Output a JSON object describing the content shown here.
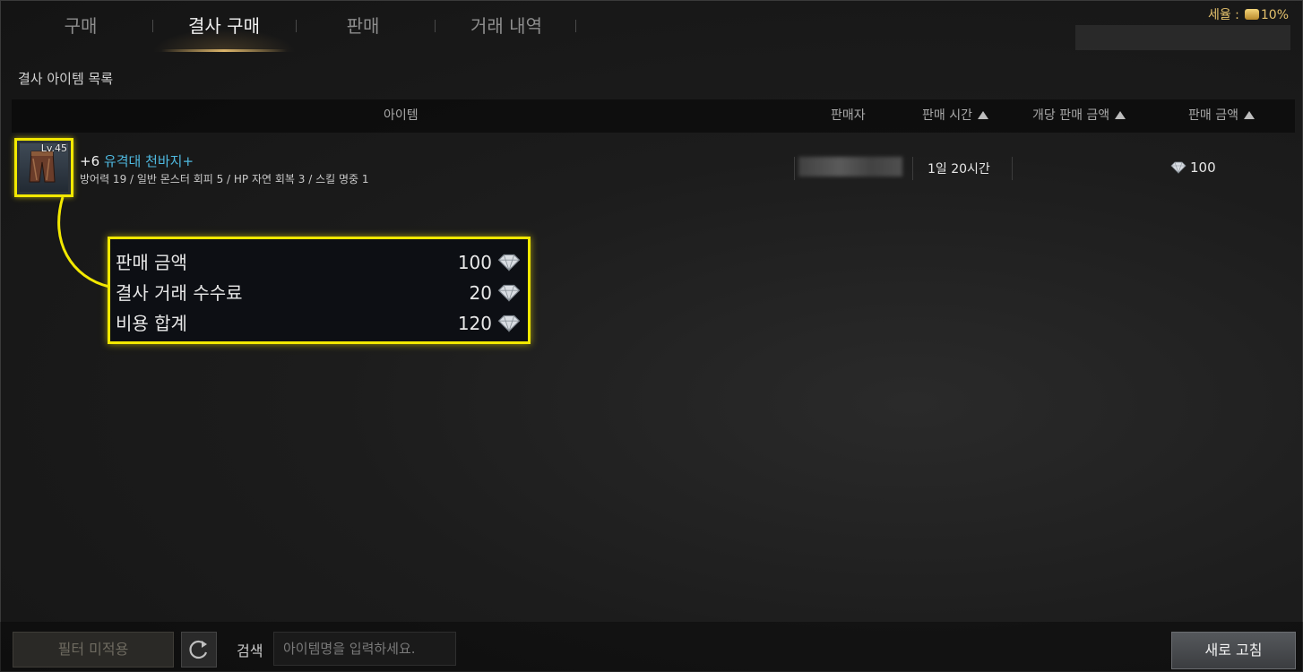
{
  "tabs": [
    {
      "label": "구매",
      "active": false
    },
    {
      "label": "결사 구매",
      "active": true
    },
    {
      "label": "판매",
      "active": false
    },
    {
      "label": "거래 내역",
      "active": false
    }
  ],
  "tax": {
    "label": "세율 :",
    "value": "10%"
  },
  "section_title": "결사 아이템 목록",
  "table": {
    "headers": {
      "item": "아이템",
      "seller": "판매자",
      "time": "판매 시간",
      "unit_price": "개당 판매 금액",
      "price": "판매 금액"
    },
    "rows": [
      {
        "level": "Lv.45",
        "enhance": "+6",
        "name": "유격대 천바지+",
        "stats": "방어력 19 / 일반 몬스터 회피 5 / HP 자연 회복 3 / 스킬 명중 1",
        "time": "1일 20시간",
        "price": "100"
      }
    ]
  },
  "callout": {
    "rows": [
      {
        "label": "판매 금액",
        "value": "100"
      },
      {
        "label": "결사 거래 수수료",
        "value": "20"
      },
      {
        "label": "비용 합계",
        "value": "120"
      }
    ]
  },
  "bottom": {
    "filter_label": "필터 미적용",
    "search_label": "검색",
    "search_placeholder": "아이템명을 입력하세요.",
    "refresh_label": "새로 고침"
  },
  "colors": {
    "highlight": "#f2e800",
    "item_name": "#4fb9e0",
    "tax": "#e4c16c"
  },
  "icons": [
    "diamond-icon",
    "coin-icon",
    "refresh-icon",
    "sort-ascending-icon",
    "pants-item-icon"
  ]
}
